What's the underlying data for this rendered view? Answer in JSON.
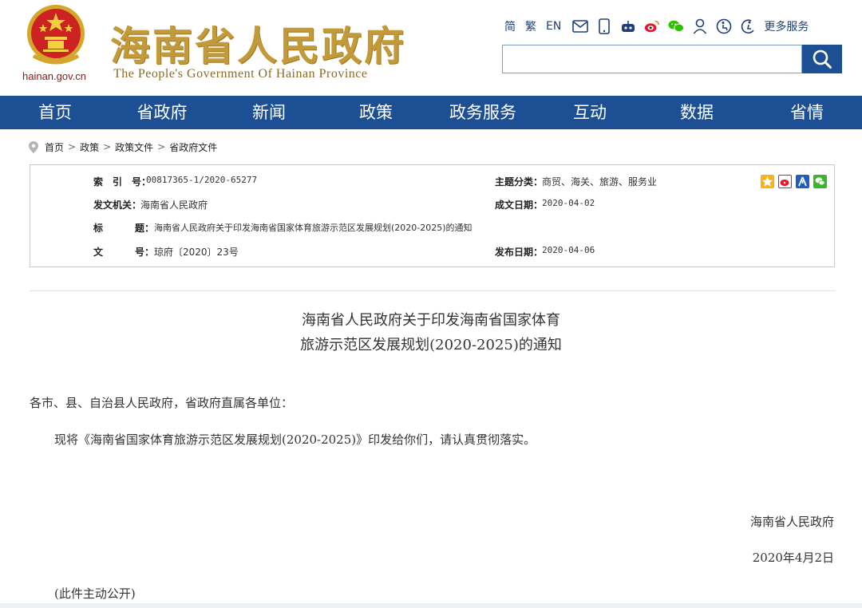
{
  "header": {
    "domain": "hainan.gov.cn",
    "title": "海南省人民政府",
    "subtitle": "The People's Government Of Hainan Province",
    "toolbar": {
      "simplified": "简",
      "traditional": "繁",
      "english": "EN",
      "icons": [
        "mail-icon",
        "mobile-icon",
        "robot-icon",
        "weibo-icon",
        "wechat-icon",
        "user-icon",
        "accessibility-icon",
        "elderly-icon"
      ],
      "more_services": "更多服务"
    },
    "search": {
      "placeholder": "",
      "value": ""
    },
    "colors": {
      "gold": "#c29a3a",
      "nav": "#1d4f94"
    }
  },
  "nav": {
    "items": [
      "首页",
      "省政府",
      "新闻",
      "政策",
      "政务服务",
      "互动",
      "数据",
      "省情"
    ]
  },
  "breadcrumb": {
    "icon": "location-pin-icon",
    "items": [
      "首页",
      "政策",
      "政策文件",
      "省政府文件"
    ],
    "separator": ">"
  },
  "info": {
    "index_label": "索　引　号：",
    "index_value": "00817365-1/2020-65277",
    "category_label": "主题分类：",
    "category_value": "商贸、海关、旅游、服务业",
    "issuer_label": "发文机关：",
    "issuer_value": "海南省人民政府",
    "date_made_label": "成文日期：",
    "date_made_value": "2020-04-02",
    "title_label_a": "标",
    "title_label_b": "题：",
    "title_value": "海南省人民政府关于印发海南省国家体育旅游示范区发展规划(2020-2025)的通知",
    "docno_label_a": "文",
    "docno_label_b": "号：",
    "docno_value": "琼府〔2020〕23号",
    "publish_label": "发布日期：",
    "publish_value": "2020-04-06",
    "share_icons": [
      "qzone-icon",
      "weibo-share-icon",
      "renren-icon",
      "wechat-share-icon"
    ]
  },
  "article": {
    "title_line1": "海南省人民政府关于印发海南省国家体育",
    "title_line2": "旅游示范区发展规划(2020-2025)的通知",
    "salutation": "各市、县、自治县人民政府，省政府直属各单位：",
    "paragraph": "现将《海南省国家体育旅游示范区发展规划(2020-2025)》印发给你们，请认真贯彻落实。",
    "signature": "海南省人民政府",
    "date": "2020年4月2日",
    "note": "(此件主动公开)"
  }
}
